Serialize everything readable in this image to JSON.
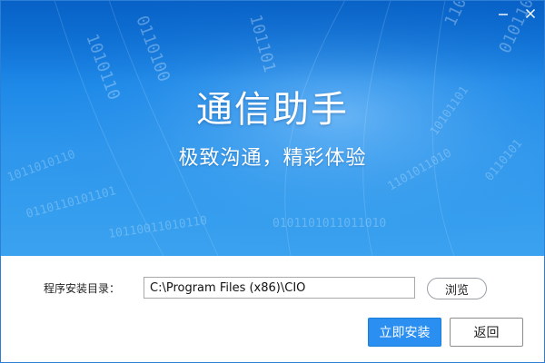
{
  "banner": {
    "title": "通信助手",
    "subtitle": "极致沟通，精彩体验",
    "background_color": "#1f8ae8",
    "decor_icon": "binary-digits-tunnel"
  },
  "window_controls": {
    "minimize_icon": "minimize-icon",
    "close_icon": "close-icon"
  },
  "form": {
    "dir_label": "程序安装目录：",
    "path_value": "C:\\Program Files (x86)\\CIO",
    "browse_label": "浏览"
  },
  "actions": {
    "install_label": "立即安装",
    "back_label": "返回",
    "install_color": "#2a8ff0"
  }
}
